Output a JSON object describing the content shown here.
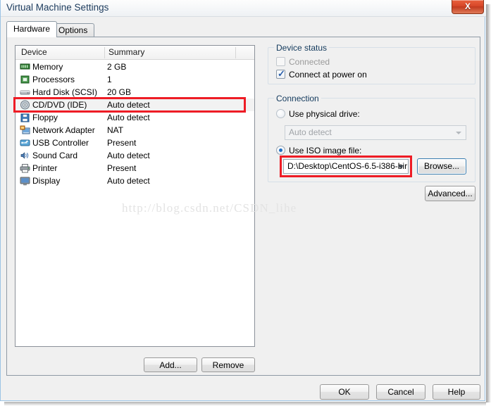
{
  "window": {
    "title": "Virtual Machine Settings",
    "close_label": "X"
  },
  "tabs": [
    {
      "label": "Hardware",
      "active": true
    },
    {
      "label": "Options",
      "active": false
    }
  ],
  "device_list": {
    "columns": [
      "Device",
      "Summary"
    ],
    "rows": [
      {
        "icon": "memory-icon",
        "device": "Memory",
        "summary": "2 GB",
        "selected": false
      },
      {
        "icon": "processor-icon",
        "device": "Processors",
        "summary": "1",
        "selected": false
      },
      {
        "icon": "hard-disk-icon",
        "device": "Hard Disk (SCSI)",
        "summary": "20 GB",
        "selected": false
      },
      {
        "icon": "cd-dvd-icon",
        "device": "CD/DVD (IDE)",
        "summary": "Auto detect",
        "selected": true
      },
      {
        "icon": "floppy-icon",
        "device": "Floppy",
        "summary": "Auto detect",
        "selected": false
      },
      {
        "icon": "network-adapter-icon",
        "device": "Network Adapter",
        "summary": "NAT",
        "selected": false
      },
      {
        "icon": "usb-controller-icon",
        "device": "USB Controller",
        "summary": "Present",
        "selected": false
      },
      {
        "icon": "sound-card-icon",
        "device": "Sound Card",
        "summary": "Auto detect",
        "selected": false
      },
      {
        "icon": "printer-icon",
        "device": "Printer",
        "summary": "Present",
        "selected": false
      },
      {
        "icon": "display-icon",
        "device": "Display",
        "summary": "Auto detect",
        "selected": false
      }
    ],
    "add_label": "Add...",
    "remove_label": "Remove"
  },
  "device_status": {
    "group_title": "Device status",
    "connected": {
      "label": "Connected",
      "checked": false,
      "disabled": true
    },
    "connect_at_power_on": {
      "label": "Connect at power on",
      "checked": true,
      "disabled": false,
      "tick": "✓"
    }
  },
  "connection": {
    "group_title": "Connection",
    "use_physical_drive": {
      "label": "Use physical drive:",
      "selected": false
    },
    "physical_drive_value": "Auto detect",
    "use_iso_image": {
      "label": "Use ISO image file:",
      "selected": true
    },
    "iso_path_value": "D:\\Desktop\\CentOS-6.5-i386-bir",
    "browse_label": "Browse...",
    "advanced_label": "Advanced..."
  },
  "watermark": "http://blog.csdn.net/CSDN_lihe",
  "footer": {
    "ok_label": "OK",
    "cancel_label": "Cancel",
    "help_label": "Help"
  },
  "colors": {
    "annotation_red": "#ee1c25",
    "title_text": "#1b3a5c",
    "group_title": "#12395c",
    "focus_blue": "#3c7fb1"
  }
}
